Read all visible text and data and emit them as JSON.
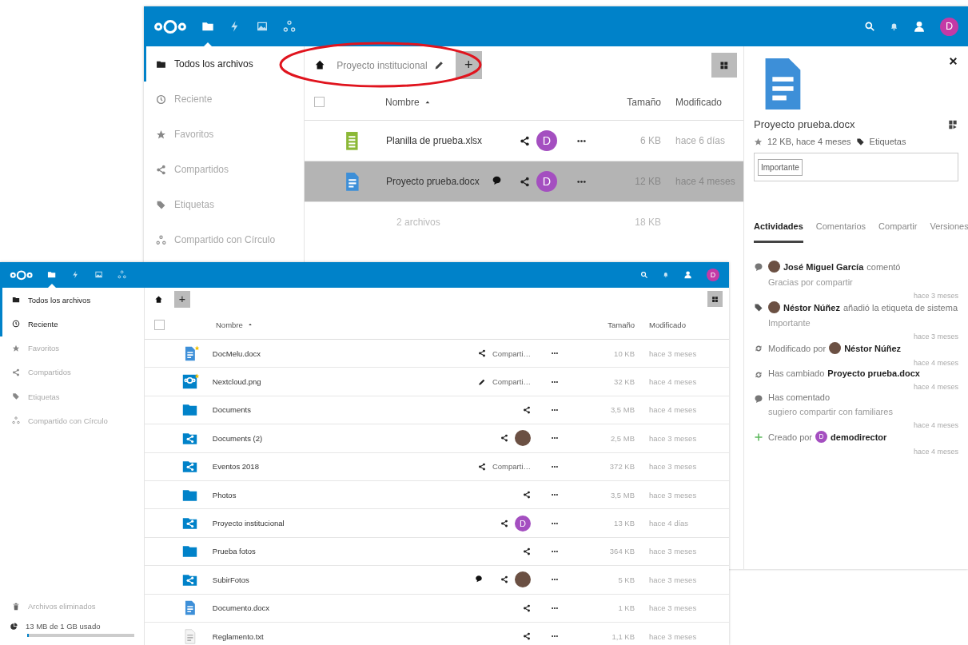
{
  "back_window": {
    "topbar": {
      "apps": [
        {
          "kind": "folder",
          "selected": true
        },
        {
          "kind": "lightning",
          "selected": false
        },
        {
          "kind": "image",
          "selected": false
        },
        {
          "kind": "circles",
          "selected": false
        }
      ],
      "avatar": "D"
    },
    "sidebar": {
      "items": [
        {
          "kind": "folder",
          "label": "Todos los archivos",
          "selected": true
        },
        {
          "kind": "clock",
          "label": "Reciente",
          "selected": false
        },
        {
          "kind": "star",
          "label": "Favoritos",
          "selected": false
        },
        {
          "kind": "share",
          "label": "Compartidos",
          "selected": false
        },
        {
          "kind": "tag",
          "label": "Etiquetas",
          "selected": false
        },
        {
          "kind": "circles",
          "label": "Compartido con Círculo",
          "selected": false
        }
      ]
    },
    "breadcrumb": {
      "folder": "Proyecto institucional",
      "new_button": "+"
    },
    "columns": {
      "name": "Nombre",
      "size": "Tamaño",
      "modified": "Modificado",
      "select_all_checked": false
    },
    "files": [
      {
        "kind": "spreadsheet",
        "name": "Planilla de prueba.xlsx",
        "selected": false,
        "comments": false,
        "share": {
          "kind": "avatar",
          "avatar": {
            "kind": "letter",
            "letter": "D"
          }
        },
        "size": "6 KB",
        "modified": "hace 6 días"
      },
      {
        "kind": "document",
        "name": "Proyecto prueba.docx",
        "selected": true,
        "comments": true,
        "share": {
          "kind": "avatar",
          "avatar": {
            "kind": "letter",
            "letter": "D"
          }
        },
        "size": "12 KB",
        "modified": "hace 4 meses"
      }
    ],
    "summary": {
      "count": "2 archivos",
      "size": "18 KB"
    },
    "details": {
      "file_name": "Proyecto prueba.docx",
      "meta": "12 KB, hace 4 meses",
      "tags_link": "Etiquetas",
      "tags": [
        "Importante"
      ],
      "tabs": [
        {
          "label": "Actividades",
          "selected": true
        },
        {
          "label": "Comentarios",
          "selected": false
        },
        {
          "label": "Compartir",
          "selected": false
        },
        {
          "label": "Versiones",
          "selected": false
        }
      ],
      "activities": [
        {
          "kind": "comment",
          "avatar": {
            "kind": "photo"
          },
          "actor": "José Miguel García",
          "text": "comentó",
          "detail": "Gracias por compartir",
          "time": "hace 3 meses"
        },
        {
          "kind": "tag",
          "avatar": {
            "kind": "photo"
          },
          "actor": "Néstor Núñez",
          "text": "añadió la etiqueta de sistema",
          "detail": "Importante",
          "time": "hace 3 meses"
        },
        {
          "kind": "change",
          "lead": "Modificado por",
          "avatar": {
            "kind": "photo"
          },
          "actor": "Néstor Núñez",
          "time": "hace 4 meses"
        },
        {
          "kind": "change",
          "lead": "Has cambiado",
          "actor": "Proyecto prueba.docx",
          "time": "hace 4 meses"
        },
        {
          "kind": "comment",
          "lead": "Has comentado",
          "detail": "sugiero compartir con familiares",
          "time": "hace 4 meses"
        },
        {
          "kind": "add",
          "lead": "Creado por",
          "avatar": {
            "kind": "letter",
            "letter": "D"
          },
          "actor": "demodirector",
          "time": "hace 4 meses"
        }
      ]
    }
  },
  "front_window": {
    "topbar": {
      "apps": [
        {
          "kind": "folder",
          "selected": true
        },
        {
          "kind": "lightning",
          "selected": false
        },
        {
          "kind": "image",
          "selected": false
        },
        {
          "kind": "circles",
          "selected": false
        }
      ],
      "avatar": "D"
    },
    "sidebar": {
      "items": [
        {
          "kind": "folder",
          "label": "Todos los archivos",
          "selected": true
        },
        {
          "kind": "clock",
          "label": "Reciente",
          "selected": true
        },
        {
          "kind": "star",
          "label": "Favoritos",
          "selected": false
        },
        {
          "kind": "share",
          "label": "Compartidos",
          "selected": false
        },
        {
          "kind": "tag",
          "label": "Etiquetas",
          "selected": false
        },
        {
          "kind": "circles",
          "label": "Compartido con Círculo",
          "selected": false
        }
      ],
      "footer": [
        {
          "kind": "trash",
          "label": "Archivos eliminados"
        }
      ],
      "quota": {
        "label": "13 MB de 1 GB usado",
        "level": 0.013
      }
    },
    "breadcrumb": {
      "new_button": "+"
    },
    "columns": {
      "name": "Nombre",
      "size": "Tamaño",
      "modified": "Modificado",
      "select_all_checked": false
    },
    "files": [
      {
        "kind": "document",
        "name": "DocMelu.docx",
        "favorite": true,
        "selected": false,
        "comments": false,
        "share": {
          "kind": "label",
          "label": "Comparti…"
        },
        "size": "10 KB",
        "modified": "hace 3 meses"
      },
      {
        "kind": "image",
        "name": "Nextcloud.png",
        "favorite": true,
        "selected": false,
        "comments": false,
        "share": {
          "kind": "link",
          "label": "Comparti…"
        },
        "size": "32 KB",
        "modified": "hace 4 meses"
      },
      {
        "kind": "folder",
        "name": "Documents",
        "favorite": false,
        "selected": false,
        "comments": false,
        "share": {
          "kind": "icon"
        },
        "size": "3,5 MB",
        "modified": "hace 4 meses"
      },
      {
        "kind": "shared-folder",
        "name": "Documents (2)",
        "favorite": false,
        "selected": false,
        "comments": false,
        "share": {
          "kind": "avatar",
          "avatar": {
            "kind": "photo"
          }
        },
        "size": "2,5 MB",
        "modified": "hace 3 meses"
      },
      {
        "kind": "shared-folder",
        "name": "Eventos 2018",
        "favorite": false,
        "selected": false,
        "comments": false,
        "share": {
          "kind": "label",
          "label": "Comparti…"
        },
        "size": "372 KB",
        "modified": "hace 3 meses"
      },
      {
        "kind": "folder",
        "name": "Photos",
        "favorite": false,
        "selected": false,
        "comments": false,
        "share": {
          "kind": "icon"
        },
        "size": "3,5 MB",
        "modified": "hace 3 meses"
      },
      {
        "kind": "shared-folder",
        "name": "Proyecto institucional",
        "favorite": false,
        "selected": false,
        "comments": false,
        "share": {
          "kind": "avatar",
          "avatar": {
            "kind": "letter",
            "letter": "D"
          }
        },
        "size": "13 KB",
        "modified": "hace 4 días"
      },
      {
        "kind": "folder",
        "name": "Prueba fotos",
        "favorite": false,
        "selected": false,
        "comments": false,
        "share": {
          "kind": "icon"
        },
        "size": "364 KB",
        "modified": "hace 3 meses"
      },
      {
        "kind": "shared-folder",
        "name": "SubirFotos",
        "favorite": false,
        "selected": false,
        "comments": true,
        "share": {
          "kind": "avatar",
          "avatar": {
            "kind": "photo"
          }
        },
        "size": "5 KB",
        "modified": "hace 3 meses"
      },
      {
        "kind": "document",
        "name": "Documento.docx",
        "favorite": false,
        "selected": false,
        "comments": false,
        "share": {
          "kind": "icon"
        },
        "size": "1 KB",
        "modified": "hace 3 meses"
      },
      {
        "kind": "text",
        "name": "Reglamento.txt",
        "favorite": false,
        "selected": false,
        "comments": false,
        "share": {
          "kind": "icon"
        },
        "size": "1,1 KB",
        "modified": "hace 3 meses"
      }
    ]
  }
}
